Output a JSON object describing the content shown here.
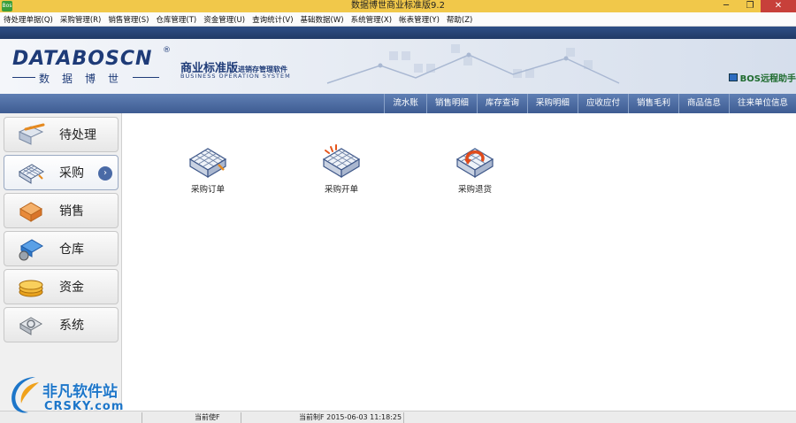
{
  "window": {
    "title": "数据博世商业标准版9.2",
    "app_icon_text": "Bos",
    "minimize_glyph": "─",
    "maximize_glyph": "❐",
    "close_glyph": "✕"
  },
  "menu": {
    "items": [
      "待处理单据(Q)",
      "采购管理(R)",
      "销售管理(S)",
      "仓库管理(T)",
      "资金管理(U)",
      "查询统计(V)",
      "基础数据(W)",
      "系统管理(X)",
      "帐表管理(Y)",
      "帮助(Z)"
    ]
  },
  "banner": {
    "logo": "DATABOSCN",
    "logo_reg": "®",
    "logo_cn": "数据博世",
    "edition": "商业标准版",
    "edition_sub": "进销存管理软件",
    "edition_en": "BUSINESS OPERATION SYSTEM",
    "remote_assist": "BOS远程助手"
  },
  "tabs": [
    "流水账",
    "销售明细",
    "库存查询",
    "采购明细",
    "应收应付",
    "销售毛利",
    "商品信息",
    "往来单位信息"
  ],
  "sidebar": {
    "items": [
      {
        "label": "待处理",
        "icon": "pending-icon"
      },
      {
        "label": "采购",
        "icon": "purchase-icon",
        "active": true,
        "arrow": "›"
      },
      {
        "label": "销售",
        "icon": "sales-icon"
      },
      {
        "label": "仓库",
        "icon": "warehouse-icon"
      },
      {
        "label": "资金",
        "icon": "funds-icon"
      },
      {
        "label": "系统",
        "icon": "system-icon"
      }
    ]
  },
  "functions": [
    {
      "label": "采购订单",
      "icon": "purchase-order-icon"
    },
    {
      "label": "采购开单",
      "icon": "purchase-invoice-icon"
    },
    {
      "label": "采购退货",
      "icon": "purchase-return-icon"
    }
  ],
  "status": {
    "current_user": "当前使F",
    "current_time": "当前制F 2015-06-03 11:18:25"
  },
  "watermark": {
    "cn": "非凡软件站",
    "en": "CRSKY.com"
  },
  "colors": {
    "title_bar": "#f1c84a",
    "top_bar": "#2f4f86",
    "tab_bar": "#4e6ea4",
    "brand": "#1e3b78",
    "watermark": "#1d76c9"
  }
}
